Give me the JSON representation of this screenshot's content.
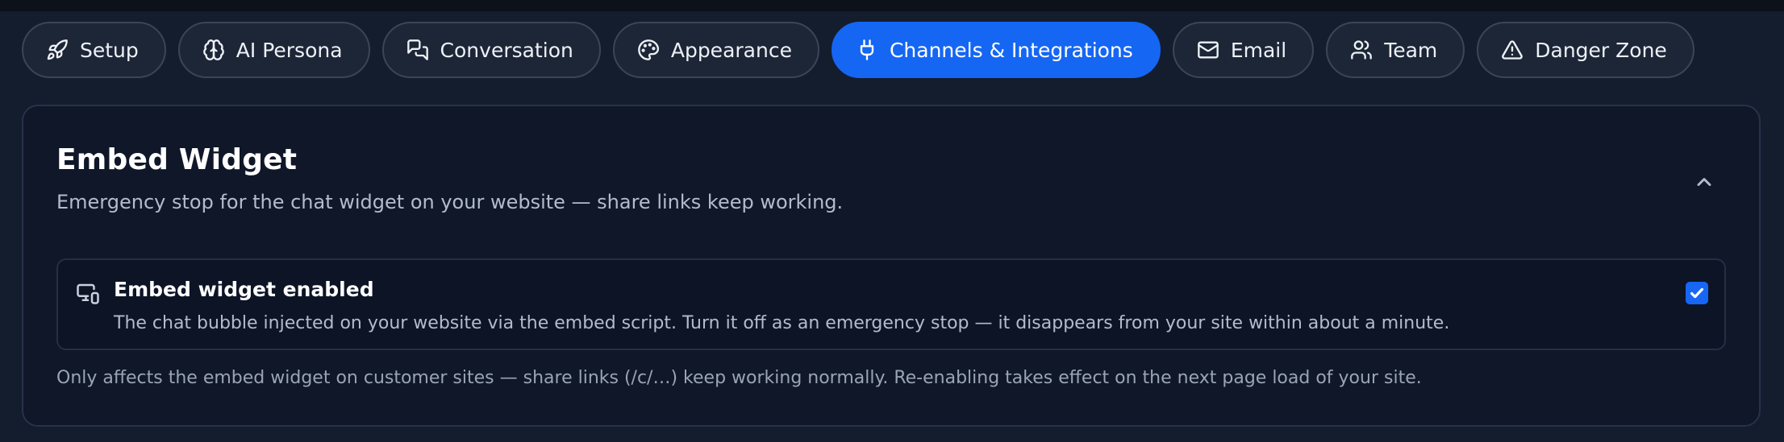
{
  "tabs": [
    {
      "label": "Setup",
      "icon": "rocket-icon",
      "active": false
    },
    {
      "label": "AI Persona",
      "icon": "brain-icon",
      "active": false
    },
    {
      "label": "Conversation",
      "icon": "chat-bubbles-icon",
      "active": false
    },
    {
      "label": "Appearance",
      "icon": "palette-icon",
      "active": false
    },
    {
      "label": "Channels & Integrations",
      "icon": "plug-icon",
      "active": true
    },
    {
      "label": "Email",
      "icon": "mail-icon",
      "active": false
    },
    {
      "label": "Team",
      "icon": "users-icon",
      "active": false
    },
    {
      "label": "Danger Zone",
      "icon": "warning-triangle-icon",
      "active": false
    }
  ],
  "section": {
    "title": "Embed Widget",
    "description": "Emergency stop for the chat widget on your website — share links keep working.",
    "collapse_icon": "chevron-up-icon",
    "setting": {
      "icon": "devices-icon",
      "title": "Embed widget enabled",
      "description": "The chat bubble injected on your website via the embed script. Turn it off as an emergency stop — it disappears from your site within about a minute.",
      "checked": true
    },
    "note": "Only affects the embed widget on customer sites — share links (/c/…) keep working normally. Re-enabling takes effect on the next page load of your site."
  },
  "colors": {
    "accent": "#1566f3",
    "background": "#141d2e",
    "card": "#0f1729"
  }
}
